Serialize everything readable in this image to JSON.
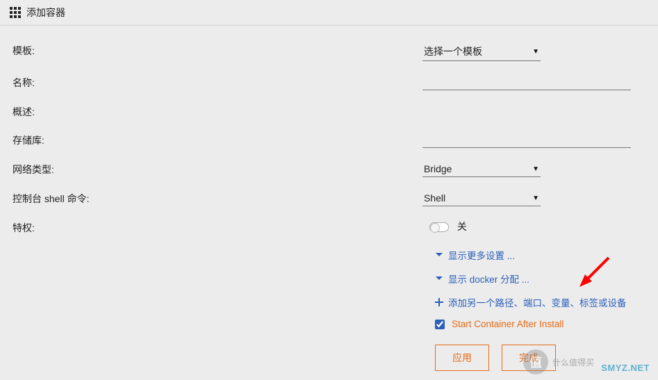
{
  "header": {
    "title": "添加容器"
  },
  "form": {
    "template": {
      "label": "模板:",
      "selected": "选择一个模板"
    },
    "name": {
      "label": "名称:",
      "value": ""
    },
    "overview": {
      "label": "概述:",
      "value": ""
    },
    "repo": {
      "label": "存储库:",
      "value": ""
    },
    "nettype": {
      "label": "网络类型:",
      "selected": "Bridge"
    },
    "shell": {
      "label": "控制台 shell 命令:",
      "selected": "Shell"
    },
    "priv": {
      "label": "特权:",
      "state": "关"
    }
  },
  "links": {
    "more_settings": "显示更多设置 ...",
    "docker_alloc": "显示 docker 分配 ...",
    "add_config": "添加另一个路径、端口、变量、标签或设备"
  },
  "checkbox": {
    "label": "Start Container After Install",
    "checked": true
  },
  "buttons": {
    "apply": "应用",
    "done": "完成"
  },
  "watermark": {
    "logo_chars": "值",
    "logo_text": "什么值得买",
    "site": "SMYZ.NET"
  },
  "colors": {
    "accent_orange": "#e56b17",
    "link_blue": "#2b5fba"
  }
}
